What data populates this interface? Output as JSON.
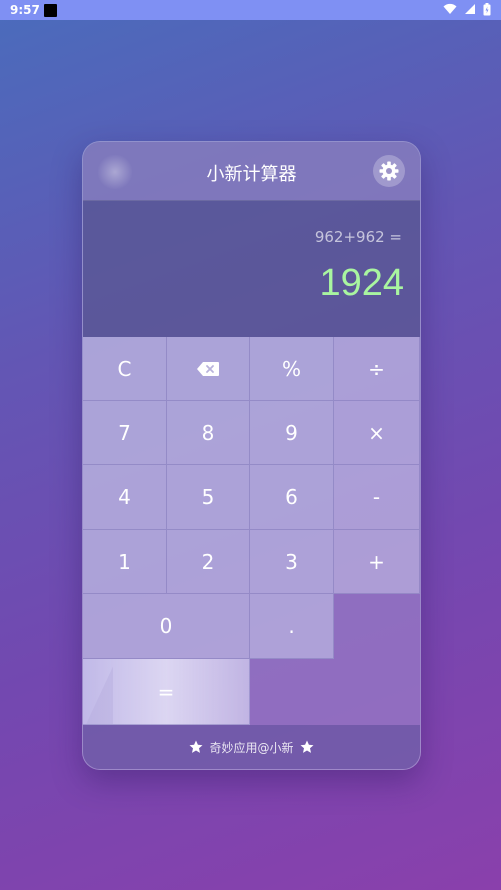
{
  "status_bar": {
    "time": "9:57",
    "icons": [
      "notification-icon",
      "wifi-icon",
      "signal-icon",
      "battery-icon"
    ]
  },
  "calculator": {
    "title": "小新计算器",
    "settings_icon": "gear-icon",
    "display": {
      "expression": "962+962 =",
      "result": "1924",
      "result_color": "#a9f5a0"
    },
    "keys": {
      "clear": "C",
      "backspace": "backspace-icon",
      "percent": "%",
      "divide": "÷",
      "seven": "7",
      "eight": "8",
      "nine": "9",
      "multiply": "×",
      "four": "4",
      "five": "5",
      "six": "6",
      "minus": "-",
      "one": "1",
      "two": "2",
      "three": "3",
      "plus": "+",
      "zero": "0",
      "dot": ".",
      "equals": "="
    },
    "footer": {
      "text": "奇妙应用@小新",
      "icon": "star-icon"
    }
  }
}
